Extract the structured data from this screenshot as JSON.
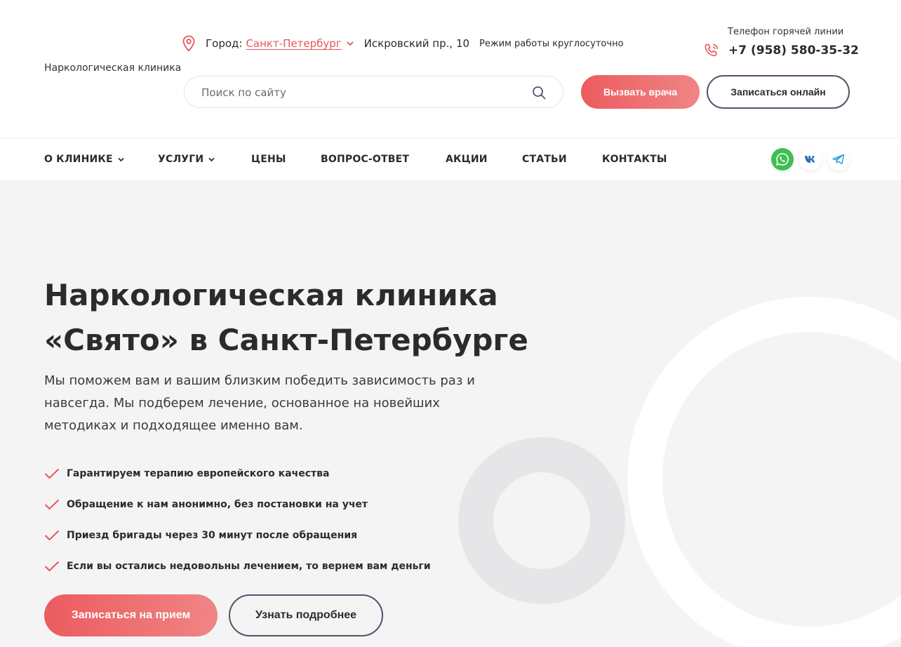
{
  "header": {
    "logo_text": "Наркологическая клиника",
    "city_label": "Город:",
    "city": "Санкт-Петербург",
    "address": "Искровский пр., 10",
    "hours": "Режим работы круглосуточно",
    "phone_caption": "Телефон горячей линии",
    "phone": "+7 (958) 580-35-32",
    "search_placeholder": "Поиск по сайту",
    "call_doctor": "Вызвать врача",
    "book_online": "Записаться онлайн"
  },
  "nav": {
    "items": [
      {
        "label": "О КЛИНИКЕ",
        "has_dropdown": true
      },
      {
        "label": "УСЛУГИ",
        "has_dropdown": true
      },
      {
        "label": "ЦЕНЫ",
        "has_dropdown": false
      },
      {
        "label": "ВОПРОС-ОТВЕТ",
        "has_dropdown": false
      },
      {
        "label": "АКЦИИ",
        "has_dropdown": false
      },
      {
        "label": "СТАТЬИ",
        "has_dropdown": false
      },
      {
        "label": "КОНТАКТЫ",
        "has_dropdown": false
      }
    ],
    "social": [
      "whatsapp-icon",
      "vk-icon",
      "telegram-icon"
    ]
  },
  "hero": {
    "title_line1": "Наркологическая клиника",
    "title_line2": "«Свято» в Санкт-Петербурге",
    "subtitle": "Мы поможем вам и вашим близким победить зависимость раз и навсегда. Мы подберем лечение, основанное на новейших методиках и подходящее именно вам.",
    "features": [
      "Гарантируем терапию европейского качества",
      "Обращение к нам анонимно, без постановки на учет",
      "Приезд бригады через 30 минут после обращения",
      "Если вы остались недовольны лечением, то вернем вам деньги"
    ],
    "btn_appoint": "Записаться на прием",
    "btn_more": "Узнать подробнее"
  },
  "colors": {
    "accent": "#ec5b5f",
    "dark": "#2b2b2b",
    "outline": "#4f5569",
    "hero_bg": "#f4f4f4"
  }
}
